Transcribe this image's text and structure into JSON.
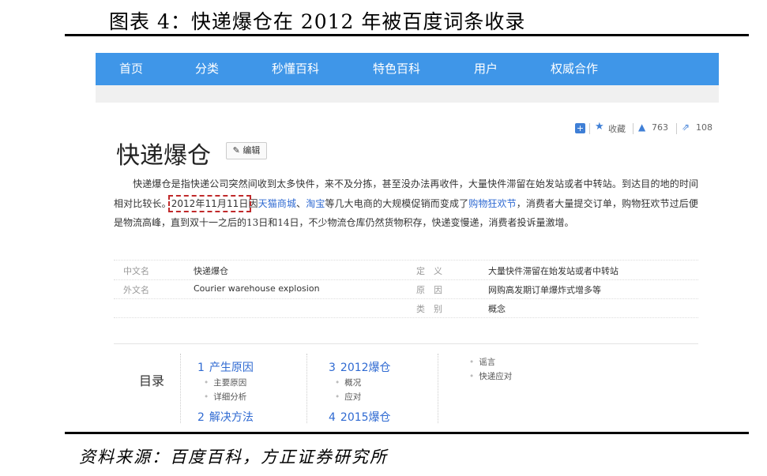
{
  "figure": {
    "title": "图表 4：快递爆仓在 2012 年被百度词条收录",
    "source": "资料来源：百度百科，方正证券研究所"
  },
  "nav": {
    "items": [
      "首页",
      "分类",
      "秒懂百科",
      "特色百科",
      "用户",
      "权威合作"
    ]
  },
  "tools": {
    "plus_icon": "plus-square-icon",
    "favorite_label": "收藏",
    "like_count": "763",
    "share_count": "108"
  },
  "entry": {
    "title": "快递爆仓",
    "edit_label": "编辑",
    "p1": "快递爆仓是指快递公司突然间收到太多快件，来不及分拣，甚至没办法再收件，大量快件滞留在始发站或者中转站。到达目的地的时间相对比较长。",
    "date": "2012年11月11日",
    "p2": "因",
    "link_tmall": "天猫商城",
    "p3": "、",
    "link_taobao": "淘宝",
    "p4": "等几大电商的大规模促销而变成了",
    "link_festival": "购物狂欢节",
    "p5": "，消费者大量提交订单，购物狂欢节过后便是物流高峰，直到双十一之后的13日和14日，不少物流仓库仍然货物积存，快递变慢递，消费者投诉量激增。"
  },
  "infobox": {
    "left": [
      {
        "key": "中文名",
        "value": "快递爆仓"
      },
      {
        "key": "外文名",
        "value": "Courier warehouse explosion"
      }
    ],
    "right": [
      {
        "key": "定　义",
        "value": "大量快件滞留在始发站或者中转站"
      },
      {
        "key": "原　因",
        "value": "网购高发期订单爆炸式增多等"
      },
      {
        "key": "类　别",
        "value": "概念"
      }
    ]
  },
  "toc": {
    "label": "目录",
    "s1": {
      "num": "1",
      "title": "产生原因",
      "subs": [
        "主要原因",
        "详细分析"
      ]
    },
    "s2": {
      "num": "2",
      "title": "解决方法"
    },
    "s3": {
      "num": "3",
      "title": "2012爆仓",
      "subs": [
        "概况",
        "应对"
      ]
    },
    "s4": {
      "num": "4",
      "title": "2015爆仓"
    },
    "extra": [
      "谣言",
      "快递应对"
    ]
  }
}
